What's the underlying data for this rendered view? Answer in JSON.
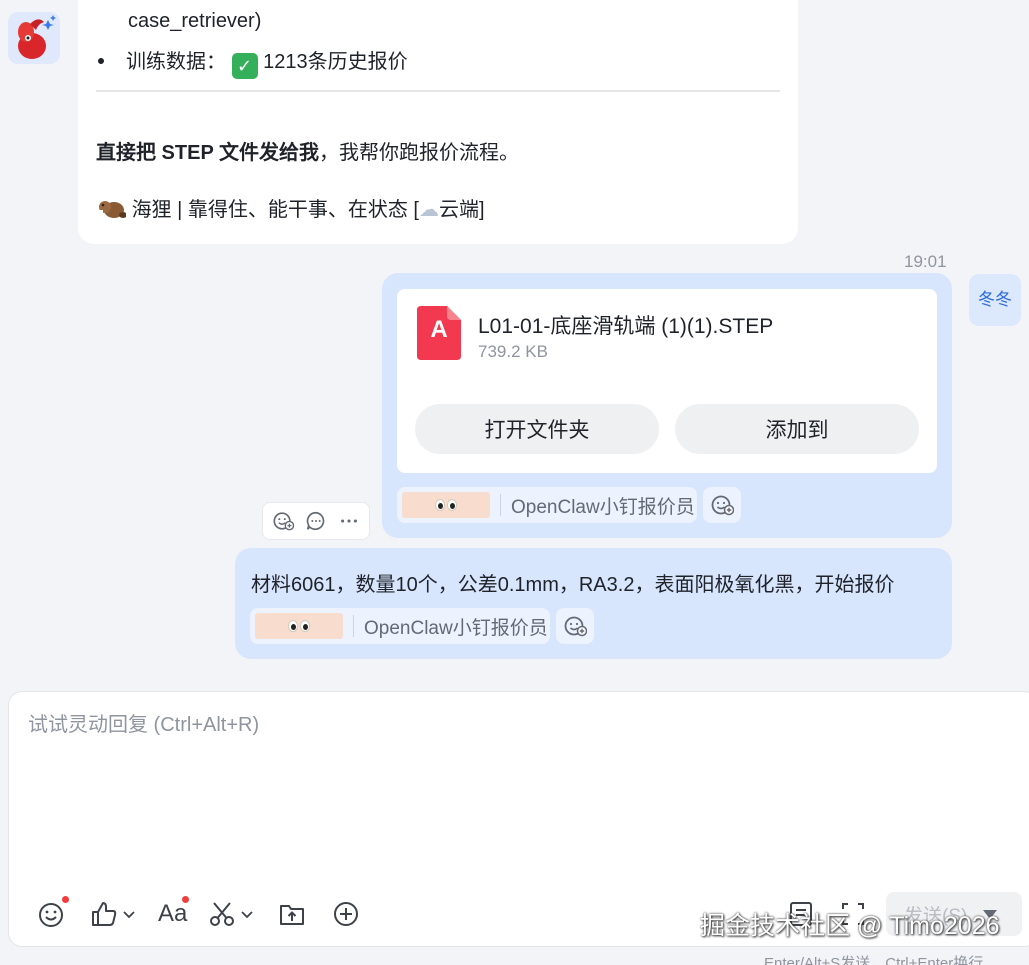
{
  "bot_message": {
    "line_top": "case_retriever)",
    "training_label": "训练数据：",
    "training_value": "1213条历史报价",
    "instruction_bold": "直接把 STEP 文件发给我",
    "instruction_rest": "，我帮你跑报价流程。",
    "signature": "海狸 | 靠得住、能干事、在状态 [",
    "signature_tag": "云端",
    "signature_close": "]"
  },
  "timestamp": "19:01",
  "user": {
    "name": "冬冬"
  },
  "file_message": {
    "file_name": "L01-01-底座滑轨端 (1)(1).STEP",
    "file_size": "739.2 KB",
    "file_type_letter": "A",
    "open_folder_label": "打开文件夹",
    "add_to_label": "添加到"
  },
  "text_message": {
    "text": "材料6061，数量10个，公差0.1mm，RA3.2，表面阳极氧化黑，开始报价"
  },
  "bot_chip": {
    "label": "OpenClaw小钉报价员"
  },
  "composer": {
    "placeholder": "试试灵动回复 (Ctrl+Alt+R)",
    "send_label": "发送(S)",
    "hint": "Enter/Alt+S发送，Ctrl+Enter换行"
  },
  "watermark": "掘金技术社区 @ Timo2026",
  "colors": {
    "accent": "#2b6be0",
    "bubble": "#d7e5fd",
    "file_icon": "#f2394f",
    "check": "#35b05a"
  }
}
